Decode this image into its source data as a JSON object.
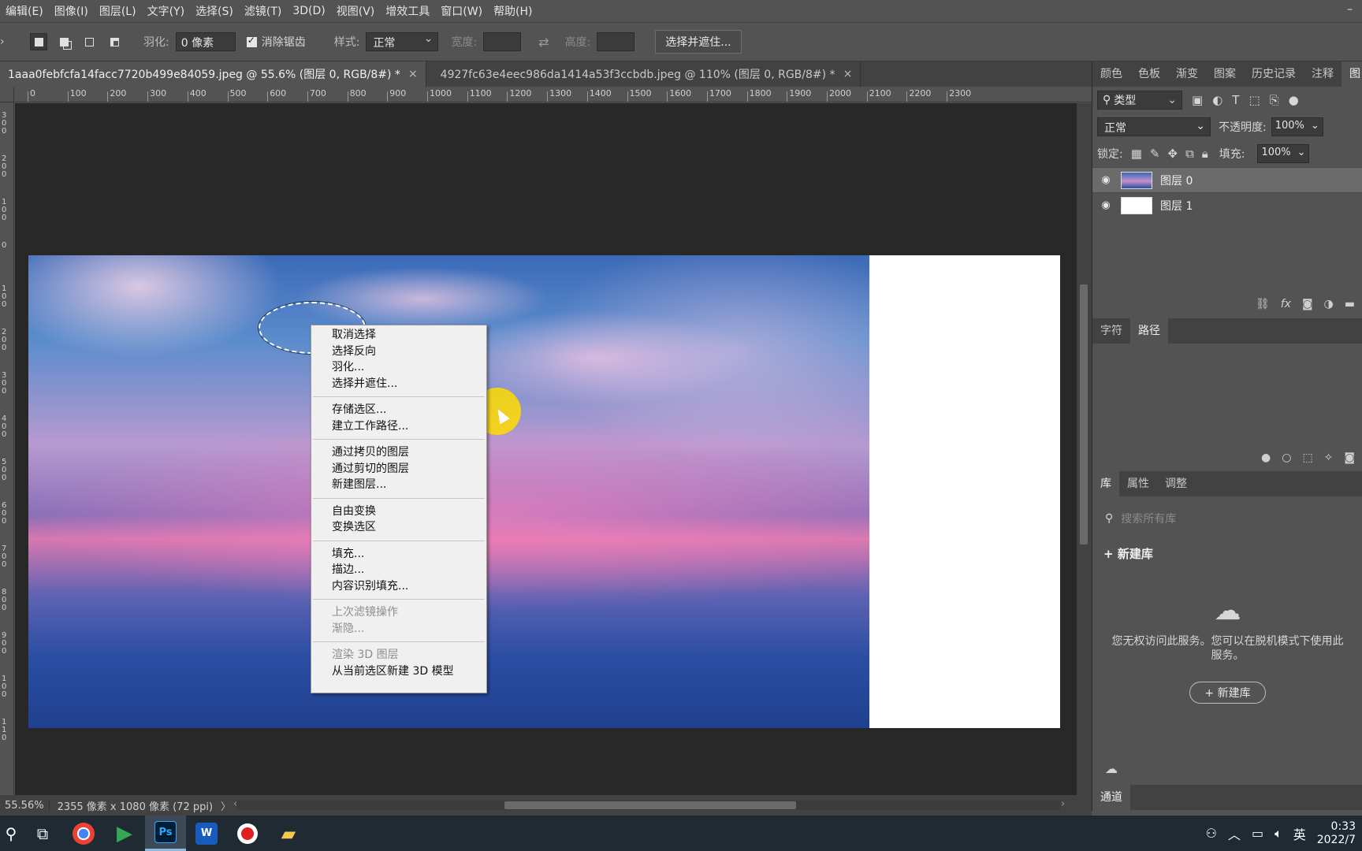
{
  "menubar": {
    "items": [
      "编辑(E)",
      "图像(I)",
      "图层(L)",
      "文字(Y)",
      "选择(S)",
      "滤镜(T)",
      "3D(D)",
      "视图(V)",
      "增效工具",
      "窗口(W)",
      "帮助(H)"
    ],
    "minimize": "–"
  },
  "options": {
    "feather_label": "羽化:",
    "feather_value": "0 像素",
    "antialias_label": "消除锯齿",
    "style_label": "样式:",
    "style_value": "正常",
    "width_label": "宽度:",
    "height_label": "高度:",
    "select_mask_button": "选择并遮住..."
  },
  "tabs": [
    {
      "label": "1aaa0febfcfa14facc7720b499e84059.jpeg @ 55.6% (图层 0, RGB/8#) *",
      "close": "×"
    },
    {
      "label": "4927fc63e4eec986da1414a53f3ccbdb.jpeg @ 110% (图层 0, RGB/8#) *",
      "close": "×"
    }
  ],
  "ruler": {
    "top": [
      "0",
      "100",
      "200",
      "300",
      "400",
      "500",
      "600",
      "700",
      "800",
      "900",
      "1000",
      "1100",
      "1200",
      "1300",
      "1400",
      "1500",
      "1600",
      "1700",
      "1800",
      "1900",
      "2000",
      "2100",
      "2200",
      "2300"
    ],
    "left": [
      "3\n0\n0",
      "2\n0\n0",
      "1\n0\n0",
      "0",
      "1\n0\n0",
      "2\n0\n0",
      "3\n0\n0",
      "4\n0\n0",
      "5\n0\n0",
      "6\n0\n0",
      "7\n0\n0",
      "8\n0\n0",
      "9\n0\n0",
      "1\n0\n0",
      "1\n1\n0"
    ]
  },
  "context_menu": {
    "groups": [
      [
        {
          "label": "取消选择",
          "enabled": true
        },
        {
          "label": "选择反向",
          "enabled": true
        },
        {
          "label": "羽化...",
          "enabled": true
        },
        {
          "label": "选择并遮住...",
          "enabled": true
        }
      ],
      [
        {
          "label": "存储选区...",
          "enabled": true
        },
        {
          "label": "建立工作路径...",
          "enabled": true
        }
      ],
      [
        {
          "label": "通过拷贝的图层",
          "enabled": true
        },
        {
          "label": "通过剪切的图层",
          "enabled": true
        },
        {
          "label": "新建图层...",
          "enabled": true
        }
      ],
      [
        {
          "label": "自由变换",
          "enabled": true
        },
        {
          "label": "变换选区",
          "enabled": true
        }
      ],
      [
        {
          "label": "填充...",
          "enabled": true
        },
        {
          "label": "描边...",
          "enabled": true
        },
        {
          "label": "内容识别填充...",
          "enabled": true
        }
      ],
      [
        {
          "label": "上次滤镜操作",
          "enabled": false
        },
        {
          "label": "渐隐...",
          "enabled": false
        }
      ],
      [
        {
          "label": "渲染 3D 图层",
          "enabled": false
        },
        {
          "label": "从当前选区新建 3D 模型",
          "enabled": true
        }
      ]
    ]
  },
  "status": {
    "zoom": "55.56%",
    "dims": "2355 像素 x 1080 像素 (72 ppi)",
    "arrow": "〉",
    "scroll_left": "‹",
    "scroll_right": "›"
  },
  "panels": {
    "top_tabs": [
      "颜色",
      "色板",
      "渐变",
      "图案",
      "历史记录",
      "注释",
      "图"
    ],
    "kind_label": "类型",
    "blend_mode": "正常",
    "opacity_label": "不透明度:",
    "opacity_value": "100%",
    "lock_label": "锁定:",
    "fill_label": "填充:",
    "fill_value": "100%",
    "layers": [
      {
        "name": "图层 0",
        "selected": true,
        "thumb": "sky"
      },
      {
        "name": "图层 1",
        "selected": false,
        "thumb": "white"
      }
    ],
    "mid_tabs": [
      "字符",
      "路径"
    ],
    "lib_tabs": [
      "库",
      "属性",
      "调整"
    ],
    "lib_search_placeholder": "搜索所有库",
    "new_library_label": "新建库",
    "lib_message": "您无权访问此服务。您可以在脱机模式下使用此服务。",
    "lib_button": "+ 新建库",
    "channels_tab": "通道"
  },
  "taskbar": {
    "ime": "英",
    "time": "0:33",
    "date": "2022/7"
  },
  "colors": {
    "panel_bg": "#535353",
    "dark_bg": "#282828",
    "menu_bg": "#f0f0f0",
    "taskbar_bg": "#1f2a33",
    "cursor_halo": "#ffdc00"
  }
}
